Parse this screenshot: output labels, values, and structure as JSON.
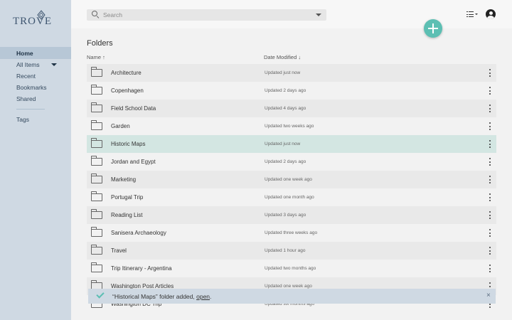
{
  "app": {
    "name": "TROVE"
  },
  "search": {
    "placeholder": "Search"
  },
  "sidebar": {
    "items": [
      {
        "label": "Home",
        "active": true
      },
      {
        "label": "All Items",
        "expandable": true
      },
      {
        "label": "Recent"
      },
      {
        "label": "Bookmarks"
      },
      {
        "label": "Shared"
      }
    ],
    "tags_label": "Tags"
  },
  "main": {
    "title": "Folders",
    "columns": {
      "name": "Name ↑",
      "date": "Date Modified ↓"
    },
    "rows": [
      {
        "name": "Architecture",
        "date": "Updated just now"
      },
      {
        "name": "Copenhagen",
        "date": "Updated 2 days ago"
      },
      {
        "name": "Field School Data",
        "date": "Updated 4 days ago"
      },
      {
        "name": "Garden",
        "date": "Updated two weeks ago"
      },
      {
        "name": "Historic Maps",
        "date": "Updated just now",
        "selected": true
      },
      {
        "name": "Jordan and Egypt",
        "date": "Updated 2 days ago"
      },
      {
        "name": "Marketing",
        "date": "Updated one week ago"
      },
      {
        "name": "Portugal Trip",
        "date": "Updated one month ago"
      },
      {
        "name": "Reading List",
        "date": "Updated 3 days ago"
      },
      {
        "name": "Sanisera Archaeology",
        "date": "Updated three weeks ago"
      },
      {
        "name": "Travel",
        "date": "Updated 1 hour ago"
      },
      {
        "name": "Trip Itinerary - Argentina",
        "date": "Updated two months ago"
      },
      {
        "name": "Washington Post Articles",
        "date": "Updated one week ago"
      },
      {
        "name": "Washington DC Trip",
        "date": "Updated six months ago"
      }
    ]
  },
  "toast": {
    "message_prefix": "“Historical Maps” folder added, ",
    "link_label": "open",
    "message_suffix": ".",
    "close_label": "×"
  },
  "colors": {
    "accent": "#5cbfb3",
    "sidebar": "#cfd9e3",
    "selected_row": "#d3e6e2"
  }
}
